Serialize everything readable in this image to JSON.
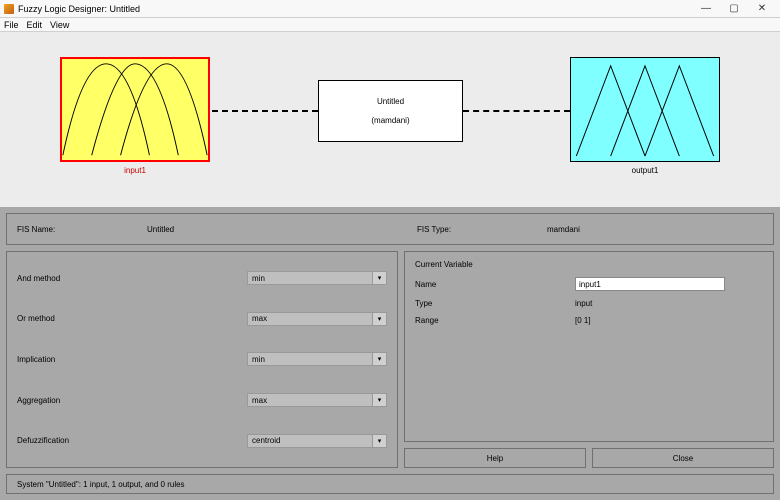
{
  "window": {
    "title": "Fuzzy Logic Designer: Untitled",
    "min": "—",
    "max": "▢",
    "close": "✕"
  },
  "menu": {
    "file": "File",
    "edit": "Edit",
    "view": "View"
  },
  "diagram": {
    "input_label": "input1",
    "output_label": "output1",
    "center_title": "Untitled",
    "center_type": "(mamdani)"
  },
  "fis": {
    "name_label": "FIS Name:",
    "name_value": "Untitled",
    "type_label": "FIS Type:",
    "type_value": "mamdani"
  },
  "methods": {
    "and": {
      "label": "And method",
      "value": "min"
    },
    "or": {
      "label": "Or method",
      "value": "max"
    },
    "imp": {
      "label": "Implication",
      "value": "min"
    },
    "agg": {
      "label": "Aggregation",
      "value": "max"
    },
    "defuz": {
      "label": "Defuzzification",
      "value": "centroid"
    }
  },
  "current_var": {
    "title": "Current Variable",
    "name_label": "Name",
    "name_value": "input1",
    "type_label": "Type",
    "type_value": "input",
    "range_label": "Range",
    "range_value": "[0 1]"
  },
  "buttons": {
    "help": "Help",
    "close": "Close"
  },
  "status": "System \"Untitled\": 1 input, 1 output, and 0 rules"
}
